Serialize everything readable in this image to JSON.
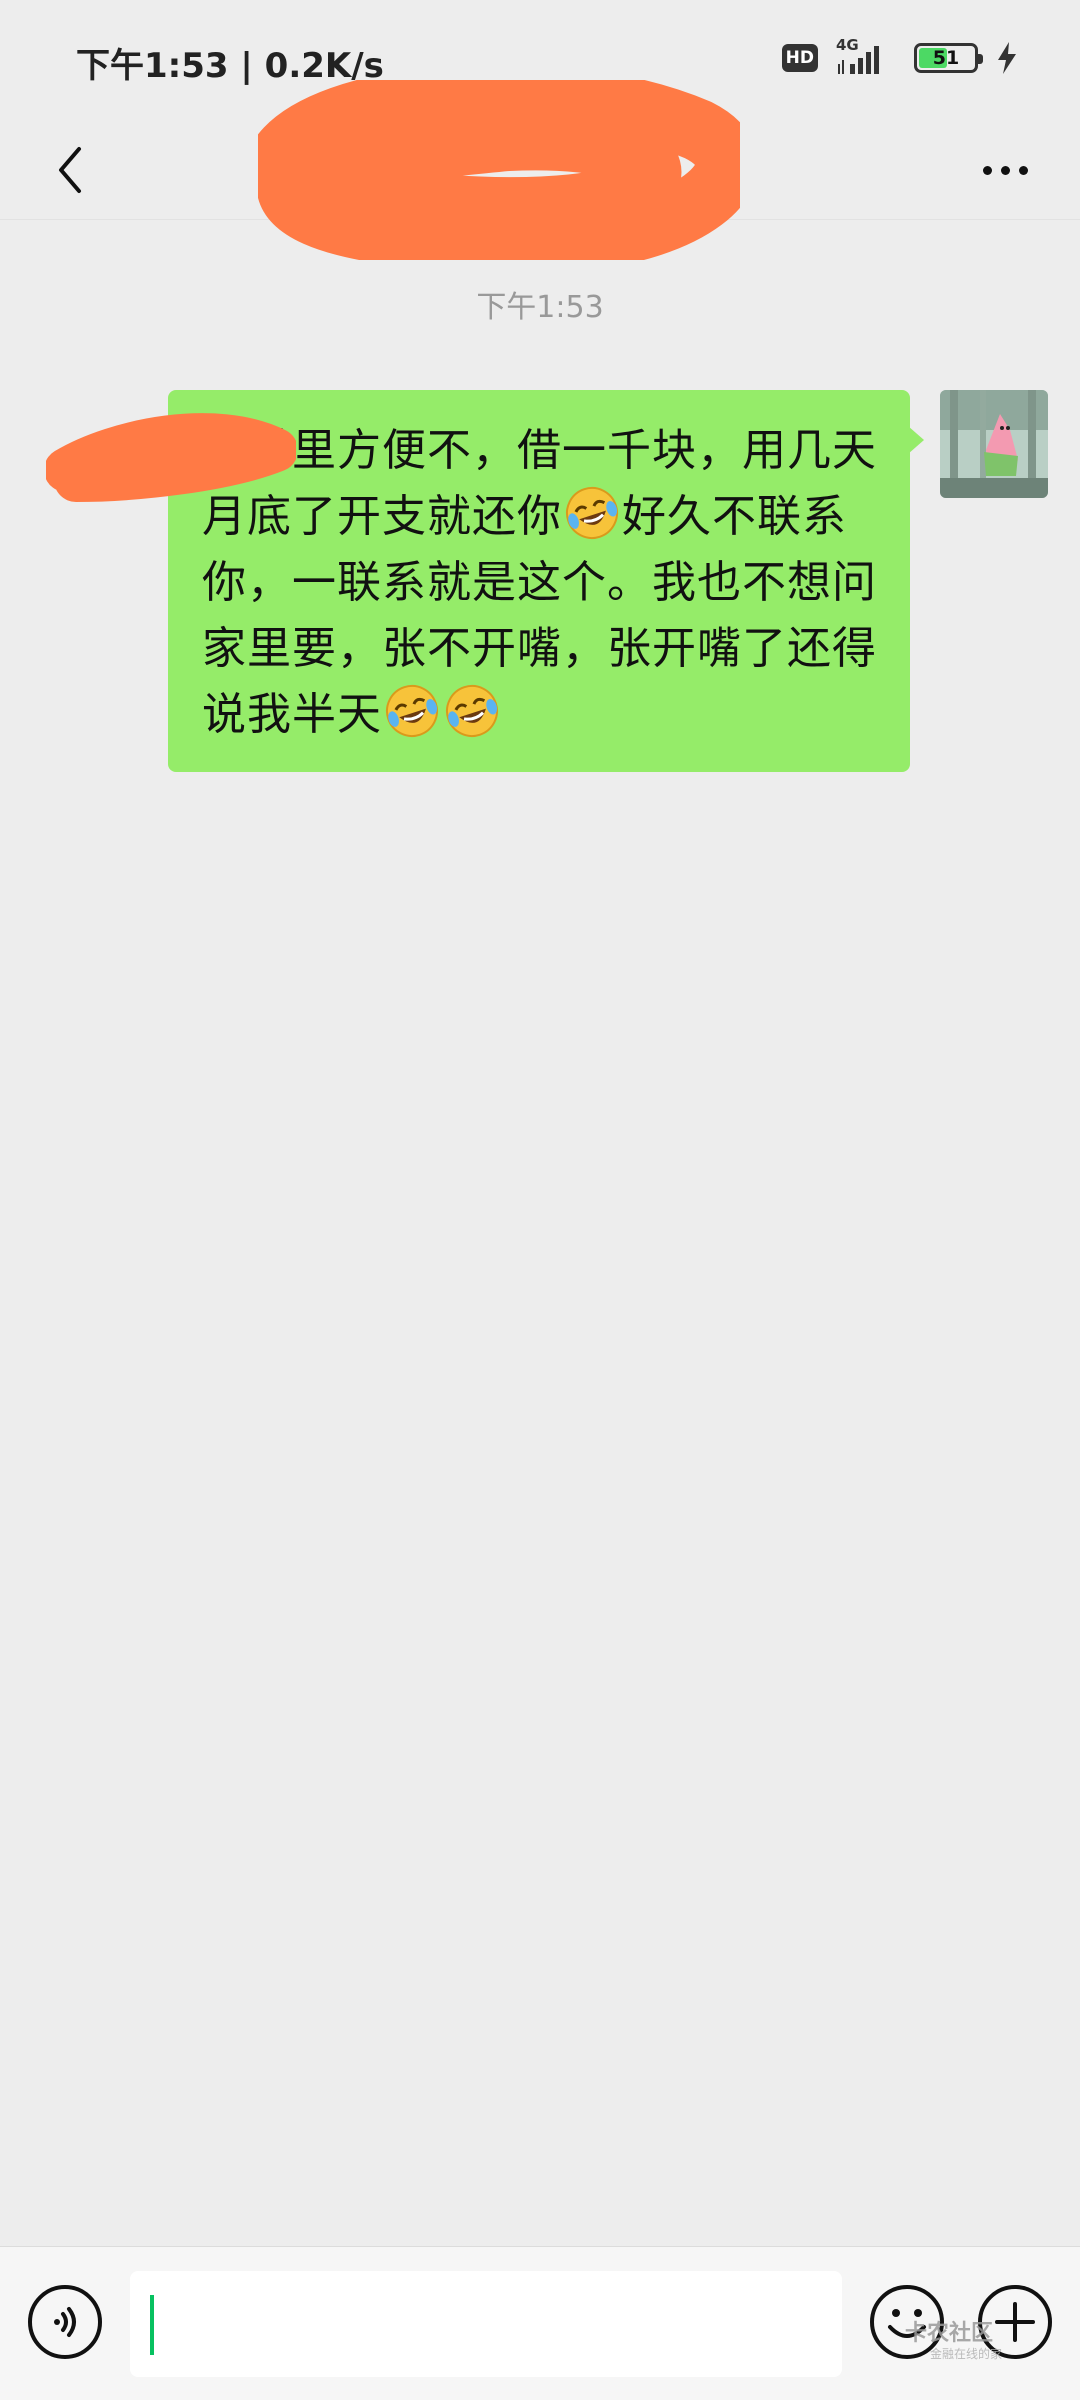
{
  "status_bar": {
    "time_speed": "下午1:53 | 0.2K/s",
    "hd_label": "HD",
    "network_label": "4G",
    "battery_level": "51",
    "battery_fraction": 0.51,
    "icons": [
      "signal-icon",
      "battery-icon",
      "charging-icon"
    ]
  },
  "nav": {
    "title": "",
    "back_icon": "chevron-left-icon",
    "more_icon": "more-dots-icon",
    "title_redacted": true
  },
  "conversation": {
    "timestamp": "下午1:53",
    "messages": [
      {
        "sender": "self",
        "segments": [
          {
            "type": "text",
            "value": "哥手里方便不，借一千块，用几天月底了开支就还你"
          },
          {
            "type": "emoji",
            "value": "laughing-crying-emoji"
          },
          {
            "type": "text",
            "value": "好久不联系你，一联系就是这个。我也不想问家里要，张不开嘴，张开嘴了还得说我半天"
          },
          {
            "type": "emoji",
            "value": "laughing-crying-emoji"
          },
          {
            "type": "emoji",
            "value": "laughing-crying-emoji"
          }
        ],
        "bubble_color": "#95ec69",
        "sender_name_redacted": true
      }
    ]
  },
  "input_bar": {
    "text_value": "",
    "voice_icon": "voice-icon",
    "emoji_icon": "emoji-icon",
    "plus_icon": "plus-icon",
    "watermark": "卡农社区",
    "watermark_sub": "金融在线的家"
  },
  "colors": {
    "background": "#ededed",
    "accent": "#07c160",
    "bubble": "#95ec69",
    "redaction": "#ff7a45"
  }
}
